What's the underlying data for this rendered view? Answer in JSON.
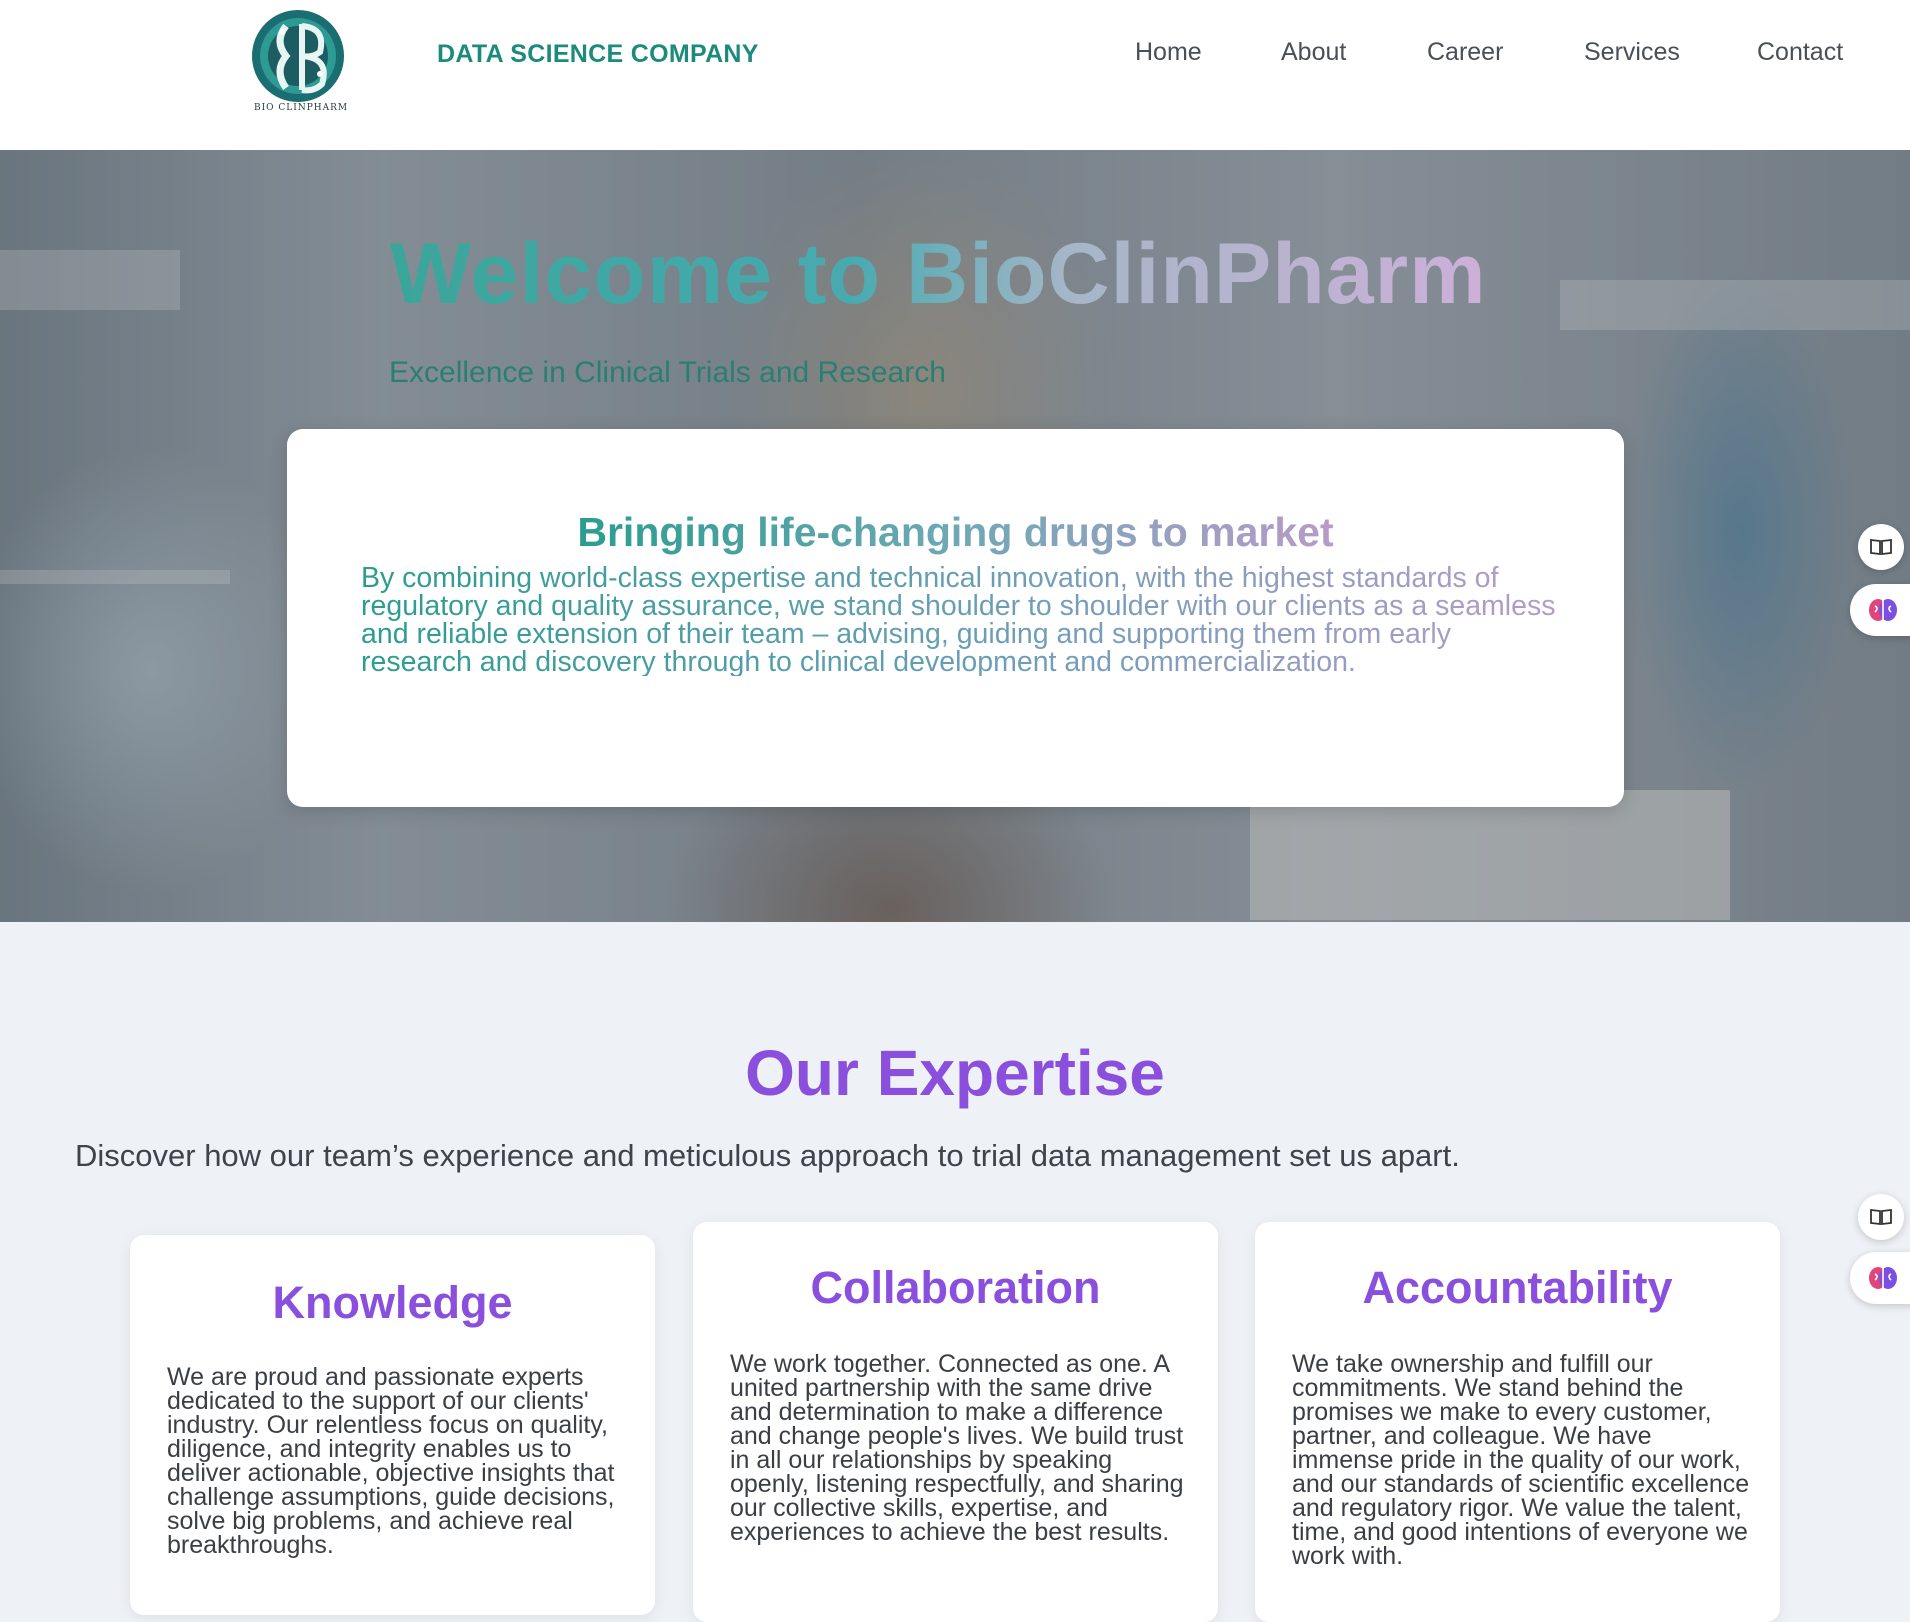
{
  "header": {
    "logo_text": "BIO CLINPHARM",
    "company_name": "DATA SCIENCE COMPANY",
    "nav": [
      {
        "label": "Home"
      },
      {
        "label": "About"
      },
      {
        "label": "Career"
      },
      {
        "label": "Services"
      },
      {
        "label": "Contact"
      }
    ]
  },
  "hero": {
    "title": "Welcome to BioClinPharm",
    "subtitle": "Excellence in Clinical Trials and Research",
    "card": {
      "heading": "Bringing life-changing drugs to market",
      "body": "By combining world-class expertise and technical innovation, with the highest standards of regulatory and quality assurance, we stand shoulder to shoulder with our clients as a seamless and reliable extension of their team – advising, guiding and supporting them from early research and discovery through to clinical development and commercialization."
    }
  },
  "expertise": {
    "title": "Our Expertise",
    "description": "Discover how our team’s experience and meticulous approach to trial data management set us apart.",
    "cards": [
      {
        "title": "Knowledge",
        "text": "We are proud and passionate experts dedicated to the support of our clients' industry. Our relentless focus on quality, diligence, and integrity enables us to deliver actionable, objective insights that challenge assumptions, guide decisions, solve big problems, and achieve real breakthroughs."
      },
      {
        "title": "Collaboration",
        "text": "We work together. Connected as one. A united partnership with the same drive and determination to make a difference and change people's lives. We build trust in all our relationships by speaking openly, listening respectfully, and sharing our collective skills, expertise, and experiences to achieve the best results."
      },
      {
        "title": "Accountability",
        "text": "We take ownership and fulfill our commitments. We stand behind the promises we make to every customer, partner, and colleague. We have immense pride in the quality of our work, and our standards of scientific excellence and regulatory rigor. We value the talent, time, and good intentions of everyone we work with."
      }
    ]
  },
  "side_widgets": {
    "icons": [
      "book-icon",
      "brain-icon"
    ]
  },
  "colors": {
    "brand_teal": "#1d8b7b",
    "accent_purple": "#8a4fdc",
    "hero_gradient_start": "#3aa69a",
    "hero_gradient_end": "#cdb0d8"
  }
}
